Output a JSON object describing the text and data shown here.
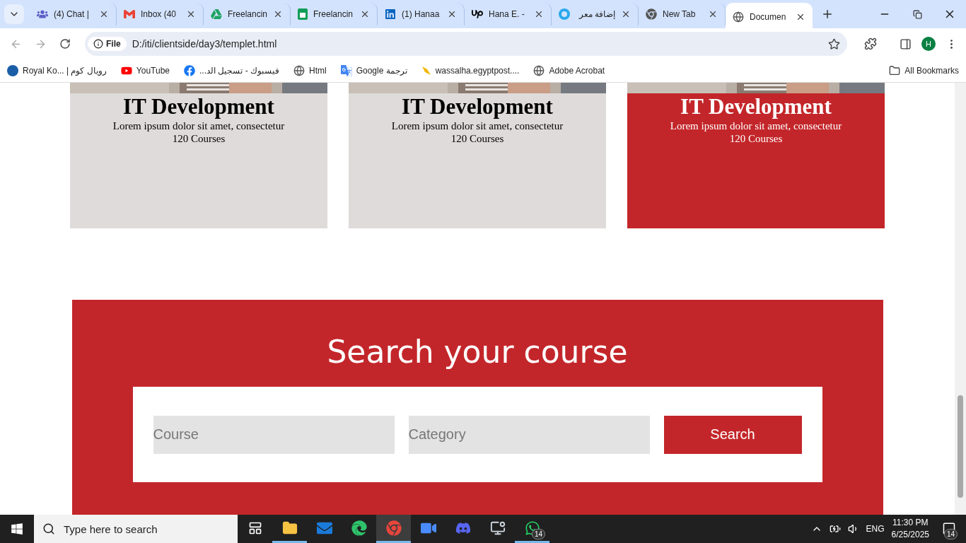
{
  "tabs": [
    {
      "title": "(4) Chat |",
      "selected": false
    },
    {
      "title": "Inbox (40",
      "selected": false
    },
    {
      "title": "Freelancin",
      "selected": false
    },
    {
      "title": "Freelancin",
      "selected": false
    },
    {
      "title": "(1) Hanaa",
      "selected": false
    },
    {
      "title": "Hana E. -",
      "selected": false
    },
    {
      "title": "إضافة معر",
      "selected": false
    },
    {
      "title": "New Tab",
      "selected": false
    },
    {
      "title": "Documen",
      "selected": true
    }
  ],
  "address_bar": {
    "scheme": "File",
    "url": "D:/iti/clientside/day3/templet.html"
  },
  "profile": {
    "initial": "H"
  },
  "bookmarks": [
    "Royal Ko... | رويال كوم",
    "YouTube",
    "فيسبوك - تسجيل الد...",
    "Html",
    "ترجمة Google",
    "wassalha.egyptpost....",
    "Adobe Acrobat"
  ],
  "all_bookmarks": "All Bookmarks",
  "cards": [
    {
      "title": "IT Development",
      "text": "Lorem ipsum dolor sit amet, consectetur",
      "count": "120 Courses",
      "highlighted": false
    },
    {
      "title": "IT Development",
      "text": "Lorem ipsum dolor sit amet, consectetur",
      "count": "120 Courses",
      "highlighted": false
    },
    {
      "title": "IT Development",
      "text": "Lorem ipsum dolor sit amet, consectetur",
      "count": "120 Courses",
      "highlighted": true
    }
  ],
  "search_section": {
    "title": "Search your course",
    "course_placeholder": "Course",
    "category_placeholder": "Category",
    "button": "Search"
  },
  "taskbar": {
    "search_placeholder": "Type here to search",
    "apps": [
      {
        "running": false,
        "active": false
      },
      {
        "running": true,
        "active": false
      },
      {
        "running": false,
        "active": false
      },
      {
        "running": false,
        "active": false
      },
      {
        "running": true,
        "active": true
      },
      {
        "running": false,
        "active": false
      },
      {
        "running": false,
        "active": false
      },
      {
        "running": false,
        "active": false
      },
      {
        "running": true,
        "active": false,
        "badge": "14"
      }
    ],
    "language": "ENG",
    "time": "11:30 PM",
    "date": "6/25/2025",
    "notifications": "14"
  }
}
